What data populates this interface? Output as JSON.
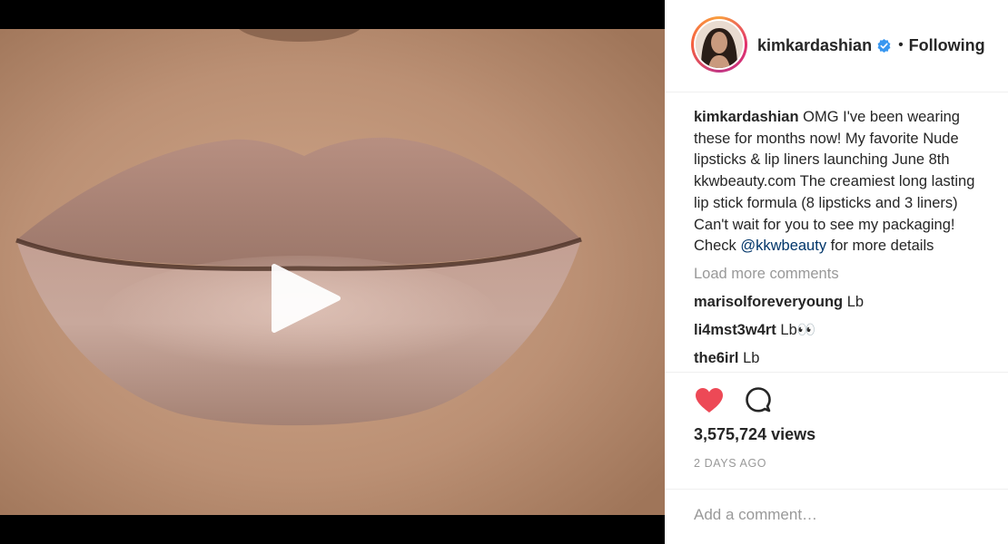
{
  "post": {
    "media": {
      "type": "video",
      "play_icon": "play-icon"
    },
    "author": {
      "username": "kimkardashian",
      "verified_icon": "verified-badge-icon",
      "separator": "•",
      "follow_status": "Following"
    },
    "caption": {
      "username": "kimkardashian",
      "lines": [
        "OMG I've been wearing",
        "these for months now! My favorite Nude",
        "lipsticks & lip liners launching June 8th",
        "kkwbeauty.com The creamiest long lasting",
        "lip stick formula (8 lipsticks and 3 liners)",
        "Can't wait for you to see my packaging!"
      ],
      "last_prefix": "Check ",
      "mention": "@kkwbeauty",
      "last_suffix": " for more details"
    },
    "load_more_label": "Load more comments",
    "comments": [
      {
        "username": "marisolforeveryoung",
        "text": "Lb"
      },
      {
        "username": "li4mst3w4rt",
        "text": "Lb👀"
      },
      {
        "username": "the6irl",
        "text": "Lb"
      }
    ],
    "actions": {
      "like_icon": "heart-icon",
      "comment_icon": "comment-icon",
      "liked": true,
      "like_color": "#ed4956"
    },
    "views": "3,575,724 views",
    "timestamp": "2 DAYS AGO",
    "add_comment_placeholder": "Add a comment…"
  }
}
